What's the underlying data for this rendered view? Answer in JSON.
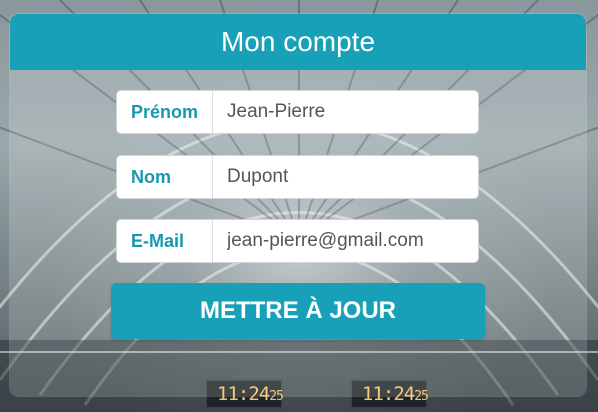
{
  "header": {
    "title": "Mon compte"
  },
  "form": {
    "fields": [
      {
        "label": "Prénom",
        "value": "Jean-Pierre"
      },
      {
        "label": "Nom",
        "value": "Dupont"
      },
      {
        "label": "E-Mail",
        "value": "jean-pierre@gmail.com"
      }
    ],
    "submit_label": "METTRE À JOUR"
  },
  "background": {
    "clocks": [
      {
        "time": "11:24",
        "seconds": "25"
      },
      {
        "time": "11:24",
        "seconds": "25"
      }
    ]
  },
  "colors": {
    "accent": "#18a0b8",
    "label_text": "#1798ae",
    "input_text": "#555555"
  }
}
